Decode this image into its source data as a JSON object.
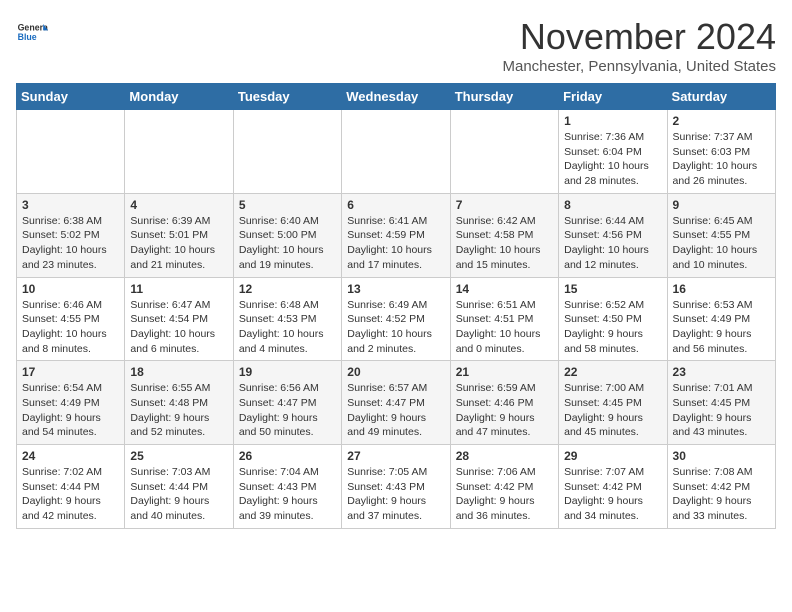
{
  "header": {
    "logo_general": "General",
    "logo_blue": "Blue",
    "month": "November 2024",
    "location": "Manchester, Pennsylvania, United States"
  },
  "days_of_week": [
    "Sunday",
    "Monday",
    "Tuesday",
    "Wednesday",
    "Thursday",
    "Friday",
    "Saturday"
  ],
  "weeks": [
    [
      {
        "day": "",
        "info": ""
      },
      {
        "day": "",
        "info": ""
      },
      {
        "day": "",
        "info": ""
      },
      {
        "day": "",
        "info": ""
      },
      {
        "day": "",
        "info": ""
      },
      {
        "day": "1",
        "info": "Sunrise: 7:36 AM\nSunset: 6:04 PM\nDaylight: 10 hours\nand 28 minutes."
      },
      {
        "day": "2",
        "info": "Sunrise: 7:37 AM\nSunset: 6:03 PM\nDaylight: 10 hours\nand 26 minutes."
      }
    ],
    [
      {
        "day": "3",
        "info": "Sunrise: 6:38 AM\nSunset: 5:02 PM\nDaylight: 10 hours\nand 23 minutes."
      },
      {
        "day": "4",
        "info": "Sunrise: 6:39 AM\nSunset: 5:01 PM\nDaylight: 10 hours\nand 21 minutes."
      },
      {
        "day": "5",
        "info": "Sunrise: 6:40 AM\nSunset: 5:00 PM\nDaylight: 10 hours\nand 19 minutes."
      },
      {
        "day": "6",
        "info": "Sunrise: 6:41 AM\nSunset: 4:59 PM\nDaylight: 10 hours\nand 17 minutes."
      },
      {
        "day": "7",
        "info": "Sunrise: 6:42 AM\nSunset: 4:58 PM\nDaylight: 10 hours\nand 15 minutes."
      },
      {
        "day": "8",
        "info": "Sunrise: 6:44 AM\nSunset: 4:56 PM\nDaylight: 10 hours\nand 12 minutes."
      },
      {
        "day": "9",
        "info": "Sunrise: 6:45 AM\nSunset: 4:55 PM\nDaylight: 10 hours\nand 10 minutes."
      }
    ],
    [
      {
        "day": "10",
        "info": "Sunrise: 6:46 AM\nSunset: 4:55 PM\nDaylight: 10 hours\nand 8 minutes."
      },
      {
        "day": "11",
        "info": "Sunrise: 6:47 AM\nSunset: 4:54 PM\nDaylight: 10 hours\nand 6 minutes."
      },
      {
        "day": "12",
        "info": "Sunrise: 6:48 AM\nSunset: 4:53 PM\nDaylight: 10 hours\nand 4 minutes."
      },
      {
        "day": "13",
        "info": "Sunrise: 6:49 AM\nSunset: 4:52 PM\nDaylight: 10 hours\nand 2 minutes."
      },
      {
        "day": "14",
        "info": "Sunrise: 6:51 AM\nSunset: 4:51 PM\nDaylight: 10 hours\nand 0 minutes."
      },
      {
        "day": "15",
        "info": "Sunrise: 6:52 AM\nSunset: 4:50 PM\nDaylight: 9 hours\nand 58 minutes."
      },
      {
        "day": "16",
        "info": "Sunrise: 6:53 AM\nSunset: 4:49 PM\nDaylight: 9 hours\nand 56 minutes."
      }
    ],
    [
      {
        "day": "17",
        "info": "Sunrise: 6:54 AM\nSunset: 4:49 PM\nDaylight: 9 hours\nand 54 minutes."
      },
      {
        "day": "18",
        "info": "Sunrise: 6:55 AM\nSunset: 4:48 PM\nDaylight: 9 hours\nand 52 minutes."
      },
      {
        "day": "19",
        "info": "Sunrise: 6:56 AM\nSunset: 4:47 PM\nDaylight: 9 hours\nand 50 minutes."
      },
      {
        "day": "20",
        "info": "Sunrise: 6:57 AM\nSunset: 4:47 PM\nDaylight: 9 hours\nand 49 minutes."
      },
      {
        "day": "21",
        "info": "Sunrise: 6:59 AM\nSunset: 4:46 PM\nDaylight: 9 hours\nand 47 minutes."
      },
      {
        "day": "22",
        "info": "Sunrise: 7:00 AM\nSunset: 4:45 PM\nDaylight: 9 hours\nand 45 minutes."
      },
      {
        "day": "23",
        "info": "Sunrise: 7:01 AM\nSunset: 4:45 PM\nDaylight: 9 hours\nand 43 minutes."
      }
    ],
    [
      {
        "day": "24",
        "info": "Sunrise: 7:02 AM\nSunset: 4:44 PM\nDaylight: 9 hours\nand 42 minutes."
      },
      {
        "day": "25",
        "info": "Sunrise: 7:03 AM\nSunset: 4:44 PM\nDaylight: 9 hours\nand 40 minutes."
      },
      {
        "day": "26",
        "info": "Sunrise: 7:04 AM\nSunset: 4:43 PM\nDaylight: 9 hours\nand 39 minutes."
      },
      {
        "day": "27",
        "info": "Sunrise: 7:05 AM\nSunset: 4:43 PM\nDaylight: 9 hours\nand 37 minutes."
      },
      {
        "day": "28",
        "info": "Sunrise: 7:06 AM\nSunset: 4:42 PM\nDaylight: 9 hours\nand 36 minutes."
      },
      {
        "day": "29",
        "info": "Sunrise: 7:07 AM\nSunset: 4:42 PM\nDaylight: 9 hours\nand 34 minutes."
      },
      {
        "day": "30",
        "info": "Sunrise: 7:08 AM\nSunset: 4:42 PM\nDaylight: 9 hours\nand 33 minutes."
      }
    ]
  ]
}
